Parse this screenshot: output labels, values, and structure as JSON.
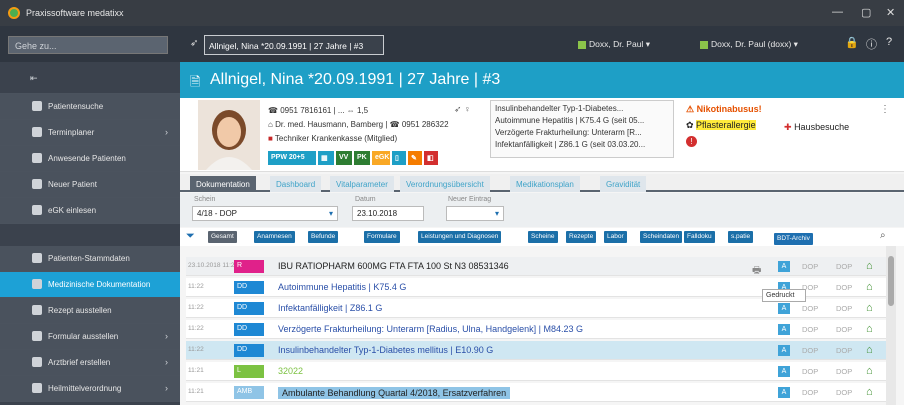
{
  "window": {
    "title": "Praxissoftware medatixx"
  },
  "toolbar": {
    "goto_placeholder": "Gehe zu...",
    "patient_selector": "Allnigel, Nina *20.09.1991 | 27 Jahre | #3",
    "doctor": "Doxx, Dr. Paul",
    "user": "Doxx, Dr. Paul (doxx)"
  },
  "sidebar": {
    "items": [
      {
        "label": "Patientensuche",
        "arrow": false
      },
      {
        "label": "Terminplaner",
        "arrow": true
      },
      {
        "label": "Anwesende Patienten",
        "arrow": false
      },
      {
        "label": "Neuer Patient",
        "arrow": false
      },
      {
        "label": "eGK einlesen",
        "arrow": false
      },
      {
        "label": "Patienten-Stammdaten",
        "arrow": false
      },
      {
        "label": "Medizinische Dokumentation",
        "arrow": false
      },
      {
        "label": "Rezept ausstellen",
        "arrow": false
      },
      {
        "label": "Formular ausstellen",
        "arrow": true
      },
      {
        "label": "Arztbrief erstellen",
        "arrow": true
      },
      {
        "label": "Heilmittelverordnung",
        "arrow": true
      }
    ]
  },
  "header": {
    "title": "Allnigel, Nina *20.09.1991 | 27 Jahre | #3"
  },
  "patient": {
    "phone": "0951 7816161 | ...",
    "rating": "1,5",
    "doctor": "Dr. med. Hausmann, Bamberg | ☎ 0951 286322",
    "insurance": "Techniker Krankenkasse (Mitglied)",
    "badges": [
      "PPW 20+5",
      "VV",
      "PK",
      "eGK"
    ]
  },
  "diagnoses": [
    "Insulinbehandelter Typ-1-Diabetes...",
    "Autoimmune Hepatitis | K75.4 G (seit 05...",
    "Verzögerte Frakturheilung: Unterarm [R...",
    "Infektanfälligkeit | Z86.1 G (seit 03.03.20..."
  ],
  "alerts": {
    "alert1": "Nikotinabusus!",
    "alert2": "Pflasterallergie",
    "hausbesuche": "Hausbesuche"
  },
  "tabs": [
    "Dokumentation",
    "Dashboard",
    "Vitalparameter",
    "Verordnungsübersicht",
    "Medikationsplan",
    "Gravidität"
  ],
  "filters": {
    "schein_label": "Schein",
    "schein_value": "4/18 - DOP",
    "datum_label": "Datum",
    "datum_value": "23.10.2018",
    "neuer_label": "Neuer Eintrag"
  },
  "chips": [
    "Gesamt",
    "Anamnesen",
    "Befunde",
    "Formulare",
    "Leistungen und Diagnosen",
    "Scheine",
    "Rezepte",
    "Labor",
    "Scheindaten",
    "Falldoku",
    "s.patie",
    "BDT-Archiv"
  ],
  "colors": {
    "accent": "#1e9fc6",
    "sidebar": "#3b424d"
  },
  "rows": [
    {
      "time": "23.10.2018 11:25",
      "tag": "R",
      "tagcolor": "#e0218a",
      "text": "IBU RATIOPHARM 600MG FTA FTA 100 St N3 08531346",
      "dop1": "DOP",
      "dop2": "DOP"
    },
    {
      "time": "11:22",
      "tag": "DD",
      "tagcolor": "#1e88d4",
      "text": "Autoimmune Hepatitis | K75.4 G",
      "dop1": "DOP",
      "dop2": "DOP"
    },
    {
      "time": "11:22",
      "tag": "DD",
      "tagcolor": "#1e88d4",
      "text": "Infektanfälligkeit | Z86.1 G",
      "dop1": "DOP",
      "dop2": "DOP"
    },
    {
      "time": "11:22",
      "tag": "DD",
      "tagcolor": "#1e88d4",
      "text": "Verzögerte Frakturheilung: Unterarm [Radius, Ulna, Handgelenk] | M84.23 G",
      "dop1": "DOP",
      "dop2": "DOP"
    },
    {
      "time": "11:22",
      "tag": "DD",
      "tagcolor": "#1e88d4",
      "text": "Insulinbehandelter Typ-1-Diabetes mellitus | E10.90 G",
      "dop1": "DOP",
      "dop2": "DOP"
    },
    {
      "time": "11:21",
      "tag": "L",
      "tagcolor": "#7cc242",
      "text": "32022",
      "dop1": "DOP",
      "dop2": "DOP"
    },
    {
      "time": "11:21",
      "tag": "AMB",
      "tagcolor": "#8fc4e6",
      "text": "Ambulante Behandlung Quartal 4/2018, Ersatzverfahren",
      "dop1": "DOP",
      "dop2": "DOP"
    }
  ],
  "tooltip": "Gedruckt"
}
